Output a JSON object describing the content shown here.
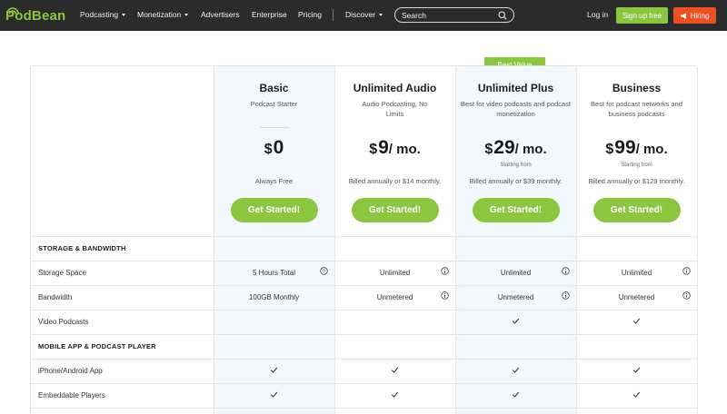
{
  "nav": {
    "logo_text": "PodBean",
    "menu": [
      {
        "label": "Podcasting",
        "has_caret": true
      },
      {
        "label": "Monetization",
        "has_caret": true
      },
      {
        "label": "Advertisers",
        "has_caret": false
      },
      {
        "label": "Enterprise",
        "has_caret": false
      },
      {
        "label": "Pricing",
        "has_caret": false
      },
      {
        "label": "Discover",
        "has_caret": true
      }
    ],
    "search_placeholder": "Search",
    "login": "Log in",
    "signup": "Sign up free",
    "hiring": "Hiring"
  },
  "badge": "Best Value",
  "plans": [
    {
      "name": "Basic",
      "desc": "Podcast Starter",
      "currency": "$",
      "amount": "0",
      "period": "",
      "starting": "",
      "billed": "Always Free",
      "cta": "Get Started!"
    },
    {
      "name": "Unlimited Audio",
      "desc": "Audio Podcasting, No Limits",
      "currency": "$",
      "amount": "9",
      "period": "/ mo.",
      "starting": "",
      "billed": "Billed annually or $14 monthly.",
      "cta": "Get Started!"
    },
    {
      "name": "Unlimited Plus",
      "desc": "Best for video podcasts and podcast monetization",
      "currency": "$",
      "amount": "29",
      "period": "/ mo.",
      "starting": "Starting from",
      "billed": "Billed annually or $39 monthly.",
      "cta": "Get Started!"
    },
    {
      "name": "Business",
      "desc": "Best for podcast networks and business podcasts",
      "currency": "$",
      "amount": "99",
      "period": "/ mo.",
      "starting": "Starting from",
      "billed": "Billed annually or $129 monthly.",
      "cta": "Get Started!"
    }
  ],
  "sections": {
    "storage": "STORAGE & BANDWIDTH",
    "mobile": "MOBILE APP & PODCAST PLAYER"
  },
  "rows": {
    "storage_space": {
      "label": "Storage Space",
      "values": [
        "5 Hours Total",
        "Unlimited",
        "Unlimited",
        "Unlimited"
      ]
    },
    "bandwidth": {
      "label": "Bandwidth",
      "values": [
        "100GB Monthly",
        "Unmetered",
        "Unmetered",
        "Unmetered"
      ]
    },
    "video": {
      "label": "Video Podcasts"
    },
    "app": {
      "label": "iPhone/Android App"
    },
    "players": {
      "label": "Embeddable Players"
    }
  },
  "colors": {
    "accent": "#8cc63f",
    "hiring": "#f04e23",
    "nav_bg": "#2b2b2b",
    "highlight_col": "#f3f8fc"
  }
}
